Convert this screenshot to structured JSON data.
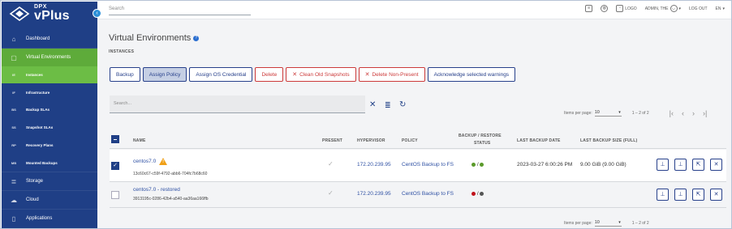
{
  "brand": {
    "top": "DPX",
    "name": "vPlus"
  },
  "sidebar": {
    "collapse_icon": "chevron-left-icon",
    "items": [
      {
        "label": "Dashboard",
        "icon": "dashboard-icon",
        "glyph": "⌂"
      },
      {
        "label": "Virtual Environments",
        "icon": "cube-icon",
        "glyph": "▢"
      },
      {
        "label": "Instances",
        "icon": "text-icon",
        "glyph": "IE"
      },
      {
        "label": "Infrastructure",
        "icon": "text-icon",
        "glyph": "IF"
      },
      {
        "label": "Backup SLAs",
        "icon": "text-icon",
        "glyph": "BS"
      },
      {
        "label": "Snapshot SLAs",
        "icon": "text-icon",
        "glyph": "SS"
      },
      {
        "label": "Recovery Plans",
        "icon": "text-icon",
        "glyph": "RP"
      },
      {
        "label": "Mounted Backups",
        "icon": "text-icon",
        "glyph": "MB"
      },
      {
        "label": "Storage",
        "icon": "storage-icon",
        "glyph": "≣"
      },
      {
        "label": "Cloud",
        "icon": "cloud-icon",
        "glyph": "☁"
      },
      {
        "label": "Applications",
        "icon": "applications-icon",
        "glyph": "▯"
      }
    ]
  },
  "topbar": {
    "search_placeholder": "Search",
    "logo_label": "LOGO",
    "user_label": "ADMIN, THE",
    "logout_label": "LOG OUT",
    "lang_label": "EN"
  },
  "page": {
    "title": "Virtual Environments",
    "subtitle": "INSTANCES"
  },
  "toolbar": {
    "buttons": [
      "Backup",
      "Assign Policy",
      "Assign OS Credential",
      "Delete",
      "Clean Old Snapshots",
      "Delete Non-Present",
      "Acknowledge selected warnings"
    ]
  },
  "filter": {
    "search_placeholder": "Search..."
  },
  "pager": {
    "label": "Items per page:",
    "per_page": "10",
    "range": "1 – 2 of 2"
  },
  "table": {
    "headers": {
      "name": "NAME",
      "present": "PRESENT",
      "hypervisor": "HYPERVISOR",
      "policy": "POLICY",
      "status_line1": "BACKUP / RESTORE",
      "status_line2": "STATUS",
      "last_date": "LAST BACKUP DATE",
      "last_size": "LAST BACKUP SIZE (FULL)"
    },
    "rows": [
      {
        "name": "centos7.0",
        "uuid": "13c60c67-c59f-4792-abb6-704fc7b68c60",
        "hypervisor": "172.20.239.95",
        "policy": "CentOS Backup to FS",
        "backup_status_color": "#5a9a2a",
        "restore_status_color": "#5a9a2a",
        "separator": "/",
        "last_date": "2023-03-27 6:00:26 PM",
        "last_size": "9.00 GiB (9.00 GiB)"
      },
      {
        "name": "centos7.0 - restored",
        "uuid": "3913195c-0286-42b4-a540-aa36aa166ffb",
        "hypervisor": "172.20.239.95",
        "policy": "CentOS Backup to FS",
        "backup_status_color": "#c0121b",
        "restore_status_color": "#555555",
        "separator": "/",
        "last_date": "",
        "last_size": ""
      }
    ]
  }
}
